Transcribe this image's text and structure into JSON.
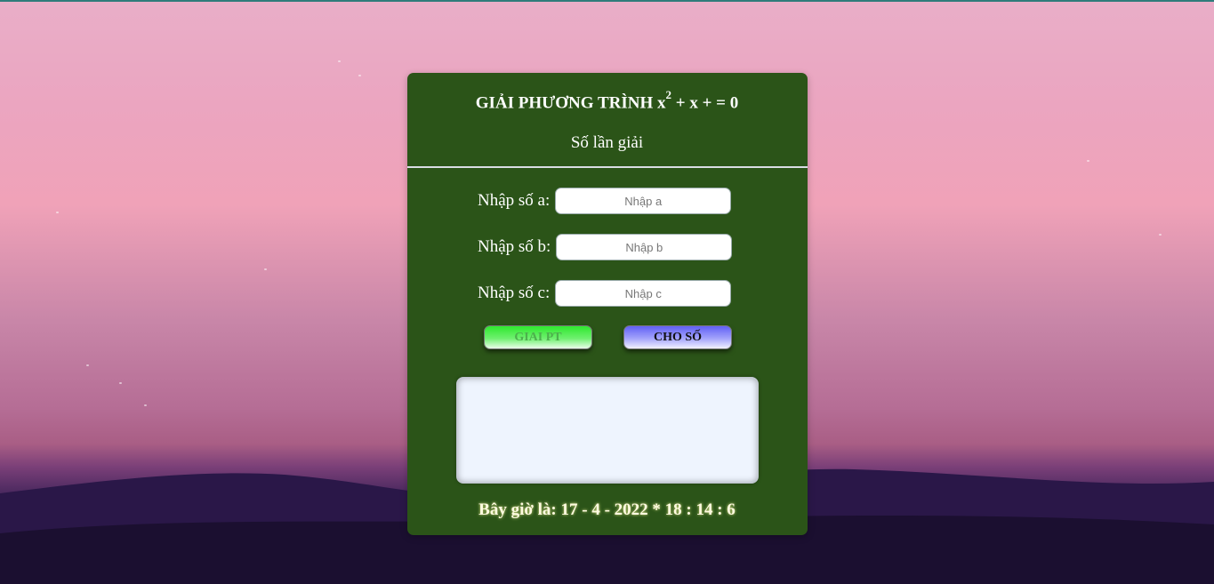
{
  "header": {
    "title_main": "GIẢI PHƯƠNG TRÌNH x",
    "title_sup": "2",
    "title_rest": " + x + = 0",
    "subtitle": "Số lần giải"
  },
  "form": {
    "a": {
      "label": "Nhập số a:",
      "placeholder": "Nhập a",
      "value": ""
    },
    "b": {
      "label": "Nhập số b:",
      "placeholder": "Nhập b",
      "value": ""
    },
    "c": {
      "label": "Nhập số c:",
      "placeholder": "Nhập c",
      "value": ""
    }
  },
  "buttons": {
    "solve": "GIAI PT",
    "random": "CHO SỐ"
  },
  "result": {
    "text": ""
  },
  "footer": {
    "clock": "Bây giờ là: 17 - 4 - 2022 * 18 : 14 : 6"
  },
  "colors": {
    "panel": "#2b5418",
    "solve_button": "#2ee82e",
    "random_button": "#6060f5",
    "result_box": "#eef4fe"
  }
}
